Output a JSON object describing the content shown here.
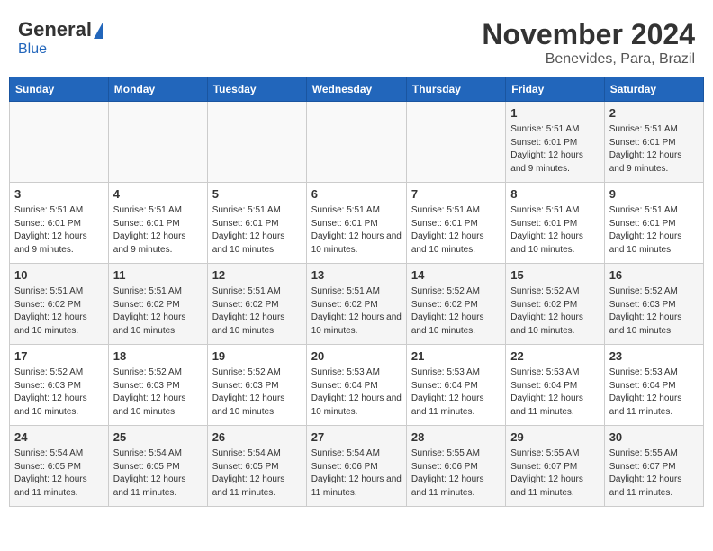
{
  "header": {
    "logo_general": "General",
    "logo_blue": "Blue",
    "month": "November 2024",
    "location": "Benevides, Para, Brazil"
  },
  "weekdays": [
    "Sunday",
    "Monday",
    "Tuesday",
    "Wednesday",
    "Thursday",
    "Friday",
    "Saturday"
  ],
  "weeks": [
    [
      {
        "day": "",
        "info": ""
      },
      {
        "day": "",
        "info": ""
      },
      {
        "day": "",
        "info": ""
      },
      {
        "day": "",
        "info": ""
      },
      {
        "day": "",
        "info": ""
      },
      {
        "day": "1",
        "info": "Sunrise: 5:51 AM\nSunset: 6:01 PM\nDaylight: 12 hours and 9 minutes."
      },
      {
        "day": "2",
        "info": "Sunrise: 5:51 AM\nSunset: 6:01 PM\nDaylight: 12 hours and 9 minutes."
      }
    ],
    [
      {
        "day": "3",
        "info": "Sunrise: 5:51 AM\nSunset: 6:01 PM\nDaylight: 12 hours and 9 minutes."
      },
      {
        "day": "4",
        "info": "Sunrise: 5:51 AM\nSunset: 6:01 PM\nDaylight: 12 hours and 9 minutes."
      },
      {
        "day": "5",
        "info": "Sunrise: 5:51 AM\nSunset: 6:01 PM\nDaylight: 12 hours and 10 minutes."
      },
      {
        "day": "6",
        "info": "Sunrise: 5:51 AM\nSunset: 6:01 PM\nDaylight: 12 hours and 10 minutes."
      },
      {
        "day": "7",
        "info": "Sunrise: 5:51 AM\nSunset: 6:01 PM\nDaylight: 12 hours and 10 minutes."
      },
      {
        "day": "8",
        "info": "Sunrise: 5:51 AM\nSunset: 6:01 PM\nDaylight: 12 hours and 10 minutes."
      },
      {
        "day": "9",
        "info": "Sunrise: 5:51 AM\nSunset: 6:01 PM\nDaylight: 12 hours and 10 minutes."
      }
    ],
    [
      {
        "day": "10",
        "info": "Sunrise: 5:51 AM\nSunset: 6:02 PM\nDaylight: 12 hours and 10 minutes."
      },
      {
        "day": "11",
        "info": "Sunrise: 5:51 AM\nSunset: 6:02 PM\nDaylight: 12 hours and 10 minutes."
      },
      {
        "day": "12",
        "info": "Sunrise: 5:51 AM\nSunset: 6:02 PM\nDaylight: 12 hours and 10 minutes."
      },
      {
        "day": "13",
        "info": "Sunrise: 5:51 AM\nSunset: 6:02 PM\nDaylight: 12 hours and 10 minutes."
      },
      {
        "day": "14",
        "info": "Sunrise: 5:52 AM\nSunset: 6:02 PM\nDaylight: 12 hours and 10 minutes."
      },
      {
        "day": "15",
        "info": "Sunrise: 5:52 AM\nSunset: 6:02 PM\nDaylight: 12 hours and 10 minutes."
      },
      {
        "day": "16",
        "info": "Sunrise: 5:52 AM\nSunset: 6:03 PM\nDaylight: 12 hours and 10 minutes."
      }
    ],
    [
      {
        "day": "17",
        "info": "Sunrise: 5:52 AM\nSunset: 6:03 PM\nDaylight: 12 hours and 10 minutes."
      },
      {
        "day": "18",
        "info": "Sunrise: 5:52 AM\nSunset: 6:03 PM\nDaylight: 12 hours and 10 minutes."
      },
      {
        "day": "19",
        "info": "Sunrise: 5:52 AM\nSunset: 6:03 PM\nDaylight: 12 hours and 10 minutes."
      },
      {
        "day": "20",
        "info": "Sunrise: 5:53 AM\nSunset: 6:04 PM\nDaylight: 12 hours and 10 minutes."
      },
      {
        "day": "21",
        "info": "Sunrise: 5:53 AM\nSunset: 6:04 PM\nDaylight: 12 hours and 11 minutes."
      },
      {
        "day": "22",
        "info": "Sunrise: 5:53 AM\nSunset: 6:04 PM\nDaylight: 12 hours and 11 minutes."
      },
      {
        "day": "23",
        "info": "Sunrise: 5:53 AM\nSunset: 6:04 PM\nDaylight: 12 hours and 11 minutes."
      }
    ],
    [
      {
        "day": "24",
        "info": "Sunrise: 5:54 AM\nSunset: 6:05 PM\nDaylight: 12 hours and 11 minutes."
      },
      {
        "day": "25",
        "info": "Sunrise: 5:54 AM\nSunset: 6:05 PM\nDaylight: 12 hours and 11 minutes."
      },
      {
        "day": "26",
        "info": "Sunrise: 5:54 AM\nSunset: 6:05 PM\nDaylight: 12 hours and 11 minutes."
      },
      {
        "day": "27",
        "info": "Sunrise: 5:54 AM\nSunset: 6:06 PM\nDaylight: 12 hours and 11 minutes."
      },
      {
        "day": "28",
        "info": "Sunrise: 5:55 AM\nSunset: 6:06 PM\nDaylight: 12 hours and 11 minutes."
      },
      {
        "day": "29",
        "info": "Sunrise: 5:55 AM\nSunset: 6:07 PM\nDaylight: 12 hours and 11 minutes."
      },
      {
        "day": "30",
        "info": "Sunrise: 5:55 AM\nSunset: 6:07 PM\nDaylight: 12 hours and 11 minutes."
      }
    ]
  ]
}
